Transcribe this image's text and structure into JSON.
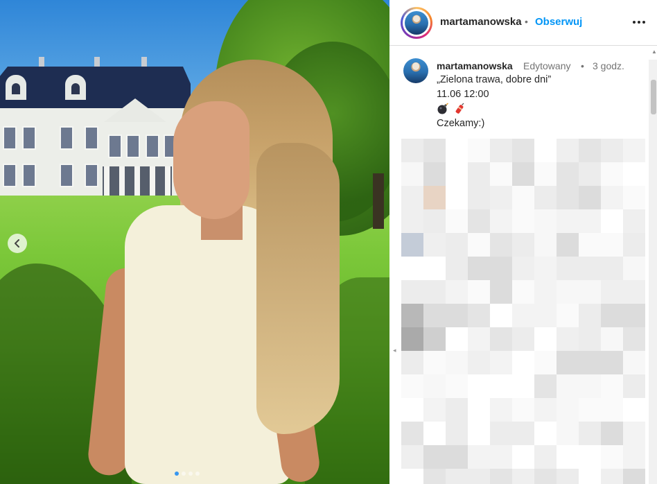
{
  "post": {
    "author": "martamanowska",
    "separator": "•",
    "follow_label": "Obserwuj",
    "edited_label": "Edytowany",
    "time_separator": "•",
    "time_ago": "3 godz.",
    "caption_lines": [
      "„Zielona trawa, dobre dni”",
      "11.06 12:00",
      "Czekamy:)"
    ]
  },
  "carousel": {
    "slide_count": 4,
    "active_index": 0
  },
  "icons": {
    "prev": "chevron-left-icon",
    "more": "more-horizontal-icon",
    "emoji_1": "bomb-emoji-icon",
    "emoji_2": "firecracker-emoji-icon"
  },
  "colors": {
    "follow_blue": "#0095f6",
    "username": "#262626",
    "muted": "#737373",
    "border": "#dbdbdb"
  }
}
